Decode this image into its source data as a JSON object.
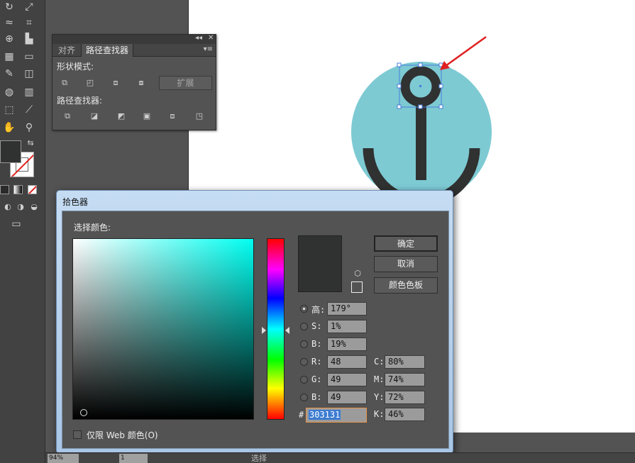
{
  "toolbar": {
    "tools": [
      "rotate-tool",
      "scale-tool",
      "warp-tool",
      "free-transform-tool",
      "shape-builder-tool",
      "graph-tool",
      "mesh-tool",
      "gradient-tool",
      "eyedropper-tool",
      "blend-tool",
      "symbol-sprayer-tool",
      "column-graph-tool",
      "artboard-tool",
      "slice-tool",
      "hand-tool",
      "zoom-tool"
    ],
    "fill_color": "#303131",
    "stroke_color": "none"
  },
  "pathfinder_panel": {
    "tabs": [
      "对齐",
      "路径查找器"
    ],
    "active_tab": "路径查找器",
    "shape_modes_label": "形状模式:",
    "expand_label": "扩展",
    "pathfinders_label": "路径查找器:"
  },
  "color_picker": {
    "title": "拾色器",
    "choose_label": "选择颜色:",
    "ok_label": "确定",
    "cancel_label": "取消",
    "swatches_label": "颜色色板",
    "fields": {
      "H": {
        "label": "高:",
        "value": "179°",
        "checked": true
      },
      "S": {
        "label": "S:",
        "value": "1%"
      },
      "Bright": {
        "label": "B:",
        "value": "19%"
      },
      "R": {
        "label": "R:",
        "value": "48"
      },
      "G": {
        "label": "G:",
        "value": "49"
      },
      "Blue": {
        "label": "B:",
        "value": "49"
      }
    },
    "cmyk": {
      "C": {
        "label": "C:",
        "value": "80%"
      },
      "M": {
        "label": "M:",
        "value": "74%"
      },
      "Y": {
        "label": "Y:",
        "value": "72%"
      },
      "K": {
        "label": "K:",
        "value": "46%"
      }
    },
    "hex_prefix": "#",
    "hex_value": "303131",
    "web_only_label": "仅限 Web 颜色(O)",
    "preview_color": "#303131",
    "hue_color": "#00fff1"
  },
  "canvas": {
    "circle_color": "#7dcad3",
    "anchor_color": "#303131",
    "arrow_color": "#e02020"
  },
  "statusbar": {
    "zoom": "94%",
    "page": "1",
    "mode": "选择"
  }
}
